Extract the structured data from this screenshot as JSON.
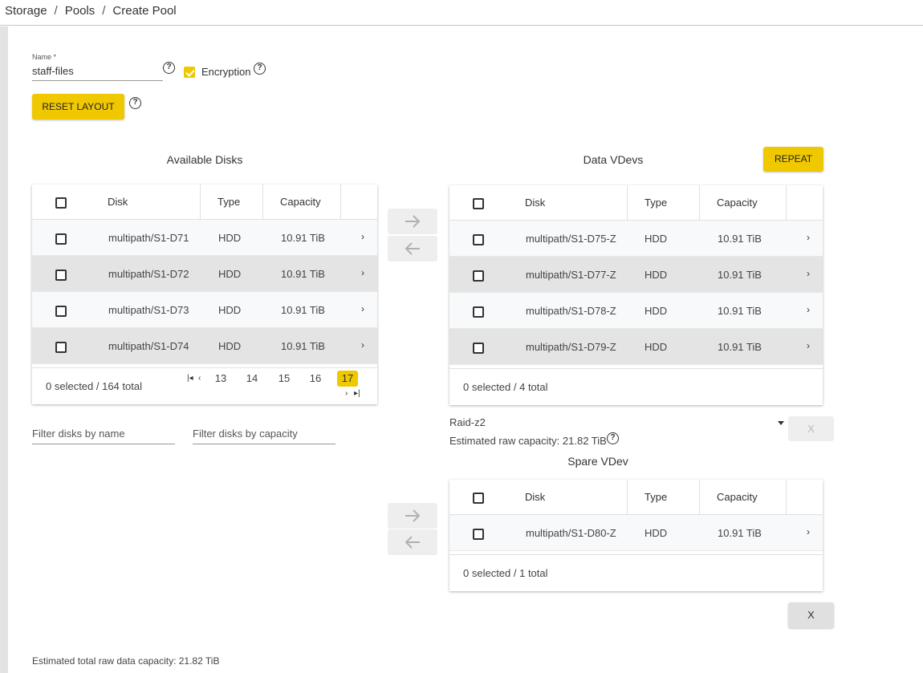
{
  "breadcrumb": {
    "items": [
      "Storage",
      "Pools",
      "Create Pool"
    ],
    "separator": "/"
  },
  "form": {
    "name_label": "Name *",
    "name_value": "staff-files",
    "encryption_label": "Encryption",
    "encryption_checked": true,
    "reset_layout_label": "RESET LAYOUT"
  },
  "available": {
    "title": "Available Disks",
    "columns": {
      "disk": "Disk",
      "type": "Type",
      "capacity": "Capacity"
    },
    "rows": [
      {
        "disk": "multipath/S1-D71",
        "type": "HDD",
        "capacity": "10.91 TiB"
      },
      {
        "disk": "multipath/S1-D72",
        "type": "HDD",
        "capacity": "10.91 TiB"
      },
      {
        "disk": "multipath/S1-D73",
        "type": "HDD",
        "capacity": "10.91 TiB"
      },
      {
        "disk": "multipath/S1-D74",
        "type": "HDD",
        "capacity": "10.91 TiB"
      }
    ],
    "footer": "0 selected / 164 total",
    "pages": [
      "13",
      "14",
      "15",
      "16",
      "17"
    ],
    "active_page": "17",
    "filter_name_placeholder": "Filter disks by name",
    "filter_capacity_placeholder": "Filter disks by capacity"
  },
  "data_vdevs": {
    "title": "Data VDevs",
    "repeat_label": "REPEAT",
    "columns": {
      "disk": "Disk",
      "type": "Type",
      "capacity": "Capacity"
    },
    "rows": [
      {
        "disk": "multipath/S1-D75-Z",
        "type": "HDD",
        "capacity": "10.91 TiB"
      },
      {
        "disk": "multipath/S1-D77-Z",
        "type": "HDD",
        "capacity": "10.91 TiB"
      },
      {
        "disk": "multipath/S1-D78-Z",
        "type": "HDD",
        "capacity": "10.91 TiB"
      },
      {
        "disk": "multipath/S1-D79-Z",
        "type": "HDD",
        "capacity": "10.91 TiB"
      }
    ],
    "footer": "0 selected / 4 total",
    "layout_value": "Raid-z2",
    "estimated_capacity": "Estimated raw capacity: 21.82 TiB",
    "remove_label": "X"
  },
  "spare_vdev": {
    "title": "Spare VDev",
    "columns": {
      "disk": "Disk",
      "type": "Type",
      "capacity": "Capacity"
    },
    "rows": [
      {
        "disk": "multipath/S1-D80-Z",
        "type": "HDD",
        "capacity": "10.91 TiB"
      }
    ],
    "footer": "0 selected / 1 total",
    "remove_label": "X"
  },
  "summary": {
    "total_capacity": "Estimated total raw data capacity: 21.82 TiB"
  },
  "icons": {
    "help": "help-circle-icon",
    "chevron": "chevron-right-icon",
    "arrow_right": "arrow-right-icon",
    "arrow_left": "arrow-left-icon"
  },
  "colors": {
    "accent": "#f0c800",
    "row_alt": "#e4e4e4",
    "row_light": "#f7f9fa"
  }
}
